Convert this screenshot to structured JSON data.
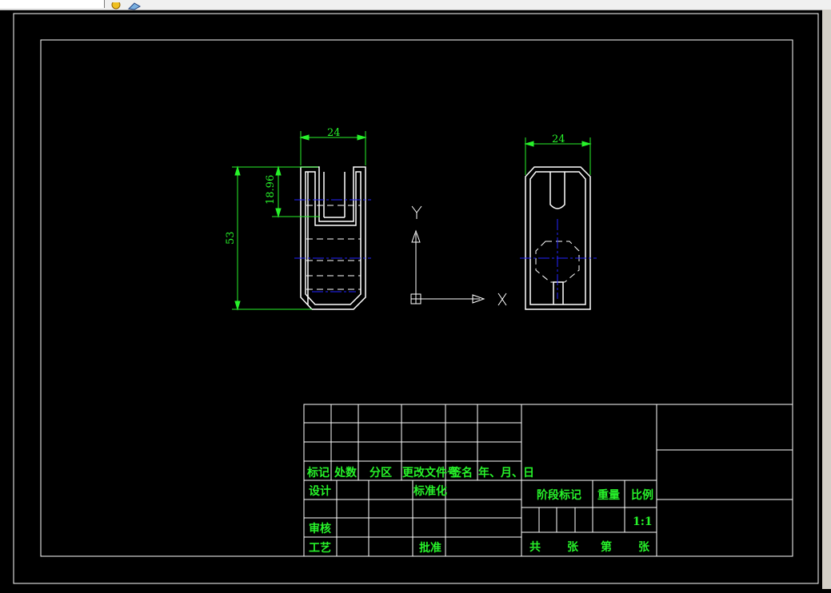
{
  "title_block": {
    "headers": [
      "标记",
      "处数",
      "分区",
      "更改文件号",
      "签名",
      "年、月、日"
    ],
    "design": "设计",
    "standardization": "标准化",
    "review": "审核",
    "process": "工艺",
    "approve": "批准",
    "stage_mark": "阶段标记",
    "weight": "重量",
    "scale": "比例",
    "scale_value": "1:1",
    "total": "共",
    "sheets1": "张",
    "sheet_no": "第",
    "sheets2": "张"
  },
  "dimensions": {
    "front_width": "24",
    "front_slot": "18.96",
    "front_height": "53",
    "side_width": "24"
  },
  "ucs": {
    "y_label": "Y",
    "x_label": "X"
  },
  "colors": {
    "lines": "#ffffff",
    "dims": "#27f22a",
    "centerlines": "#2323ff",
    "background": "#000000"
  }
}
